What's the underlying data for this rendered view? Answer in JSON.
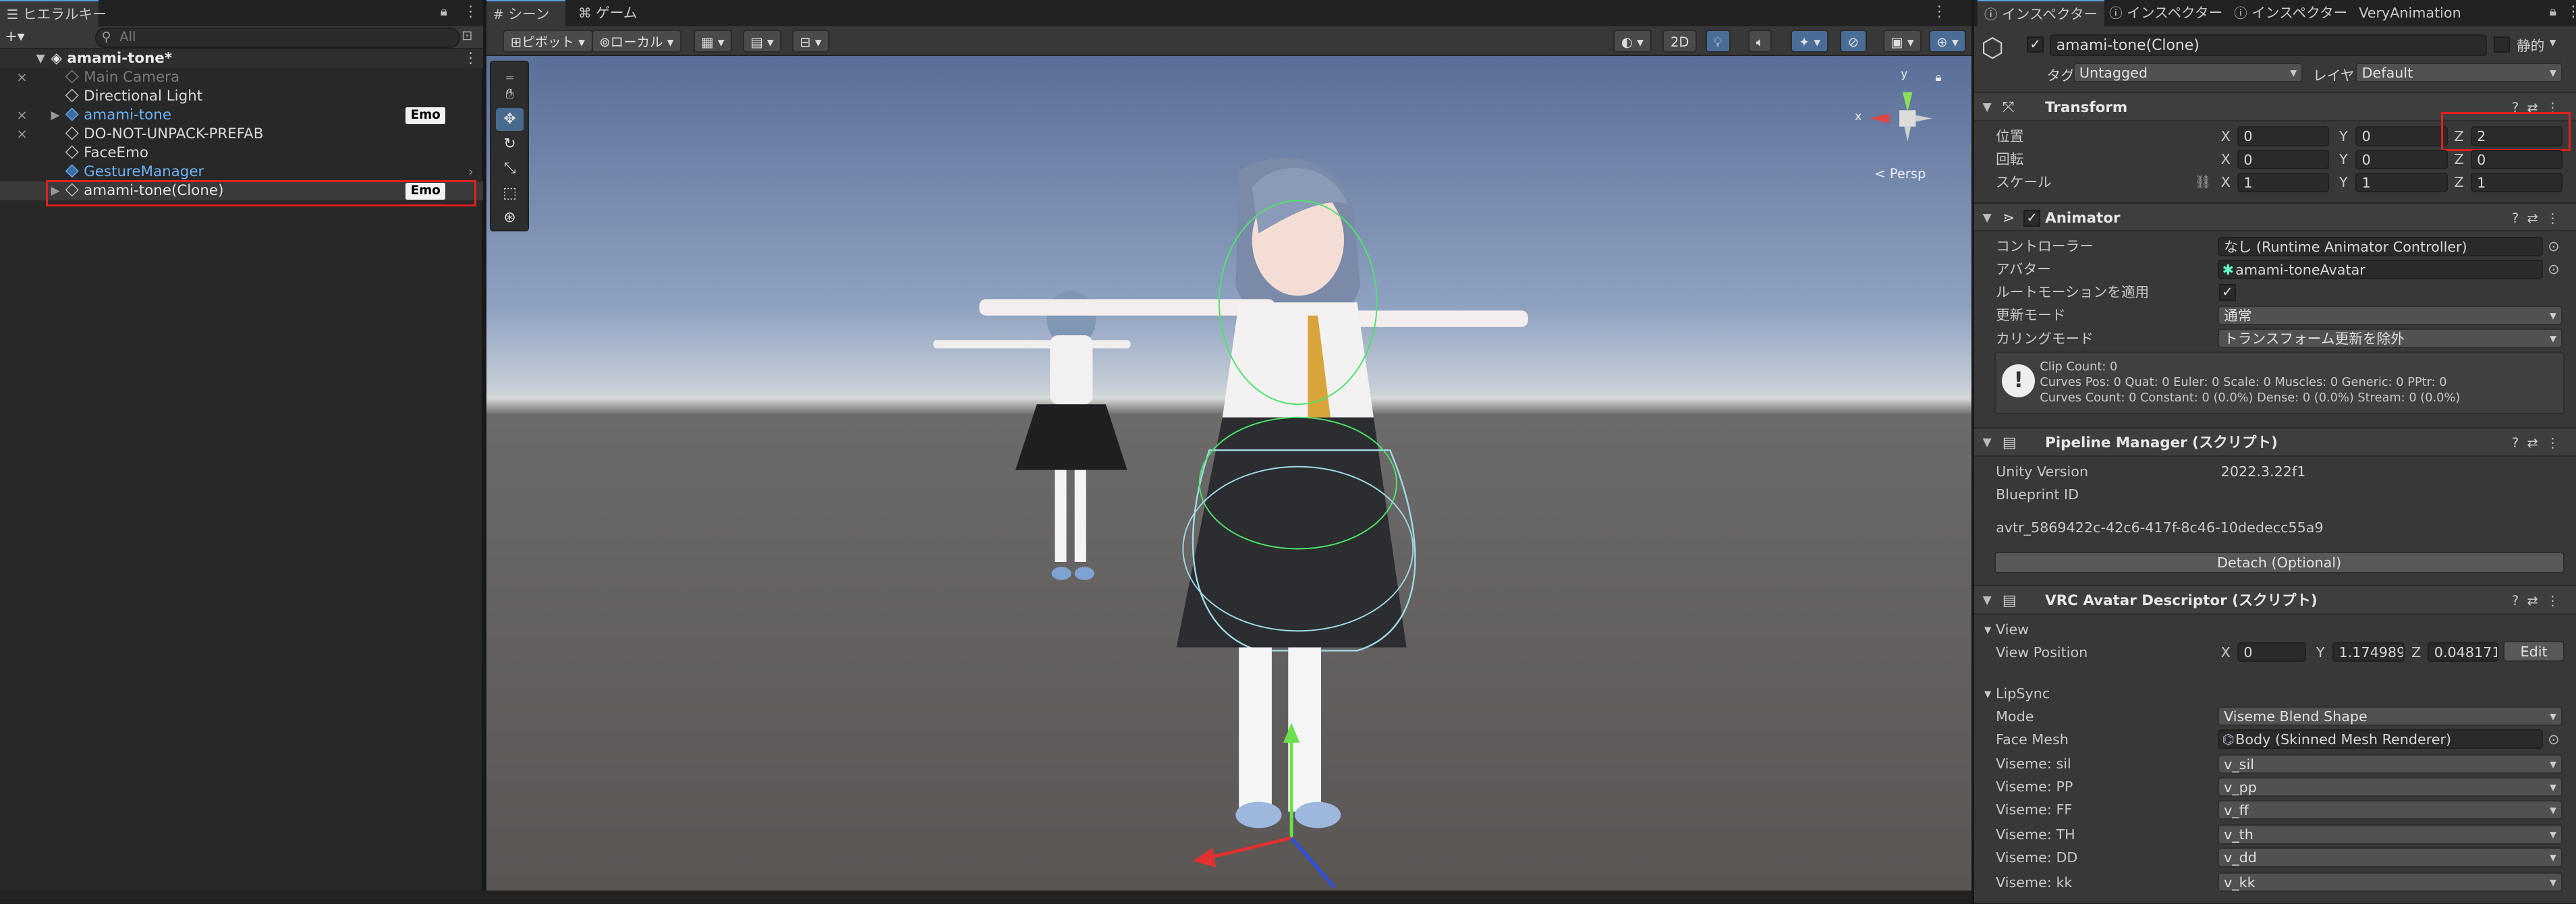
{
  "hierarchy": {
    "tab": "ヒエラルキー",
    "add": "+▾",
    "search_placeholder": "All",
    "root": "amami-tone*",
    "items": [
      {
        "label": "Main Camera"
      },
      {
        "label": "Directional Light"
      },
      {
        "label": "amami-tone",
        "badge": "Emo"
      },
      {
        "label": "DO-NOT-UNPACK-PREFAB"
      },
      {
        "label": "FaceEmo"
      },
      {
        "label": "GestureManager"
      },
      {
        "label": "amami-tone(Clone)",
        "badge": "Emo"
      }
    ]
  },
  "scene": {
    "tabs": [
      "シーン",
      "ゲーム"
    ],
    "pivot": "ピボット",
    "local": "ローカル",
    "mode_2d": "2D",
    "persp": "< Persp",
    "gizmo_x": "x",
    "gizmo_y": "y"
  },
  "inspector": {
    "tabs": [
      "インスペクター",
      "インスペクター",
      "インスペクター",
      "VeryAnimation"
    ],
    "object_name": "amami-tone(Clone)",
    "static_label": "静的",
    "tag_label": "タグ",
    "tag_value": "Untagged",
    "layer_label": "レイヤー",
    "layer_value": "Default",
    "transform": {
      "title": "Transform",
      "position_label": "位置",
      "rotation_label": "回転",
      "scale_label": "スケール",
      "x": "X",
      "y": "Y",
      "z": "Z",
      "position": [
        "0",
        "0",
        "2"
      ],
      "rotation": [
        "0",
        "0",
        "0"
      ],
      "scale": [
        "1",
        "1",
        "1"
      ]
    },
    "animator": {
      "title": "Animator",
      "controller_label": "コントローラー",
      "controller_value": "なし (Runtime Animator Controller)",
      "avatar_label": "アバター",
      "avatar_value": "amami-toneAvatar",
      "rootmotion_label": "ルートモーションを適用",
      "update_label": "更新モード",
      "update_value": "通常",
      "culling_label": "カリングモード",
      "culling_value": "トランスフォーム更新を除外",
      "info": [
        "Clip Count: 0",
        "Curves Pos: 0 Quat: 0 Euler: 0 Scale: 0 Muscles: 0 Generic: 0 PPtr: 0",
        "Curves Count: 0 Constant: 0 (0.0%) Dense: 0 (0.0%) Stream: 0 (0.0%)"
      ]
    },
    "pipeline": {
      "title": "Pipeline Manager (スクリプト)",
      "unity_label": "Unity Version",
      "unity_value": "2022.3.22f1",
      "blueprint_label": "Blueprint ID",
      "blueprint_value": "avtr_5869422c-42c6-417f-8c46-10dedecc55a9",
      "detach": "Detach (Optional)"
    },
    "descriptor": {
      "title": "VRC Avatar Descriptor (スクリプト)",
      "view_section": "View",
      "view_pos_label": "View Position",
      "view_pos": [
        "0",
        "1.174989",
        "0.0481713"
      ],
      "edit": "Edit",
      "lipsync_section": "LipSync",
      "mode_label": "Mode",
      "mode_value": "Viseme Blend Shape",
      "face_label": "Face Mesh",
      "face_value": "Body (Skinned Mesh Renderer)",
      "visemes": [
        {
          "label": "Viseme: sil",
          "value": "v_sil"
        },
        {
          "label": "Viseme: PP",
          "value": "v_pp"
        },
        {
          "label": "Viseme: FF",
          "value": "v_ff"
        },
        {
          "label": "Viseme: TH",
          "value": "v_th"
        },
        {
          "label": "Viseme: DD",
          "value": "v_dd"
        },
        {
          "label": "Viseme: kk",
          "value": "v_kk"
        }
      ]
    }
  },
  "colors": {
    "highlight": "#e02020",
    "accent": "#5a9de0"
  }
}
